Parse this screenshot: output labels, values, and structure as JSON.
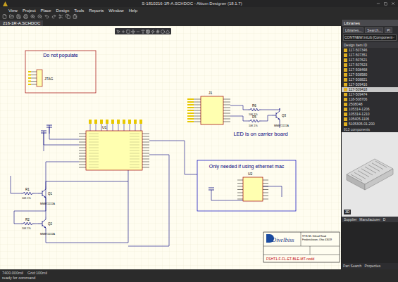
{
  "window": {
    "title": "S-1810216-1R-A.SCHDOC - Altium Designer (18.1.7)"
  },
  "menu": [
    "View",
    "Project",
    "Place",
    "Design",
    "Tools",
    "Reports",
    "Window",
    "Help"
  ],
  "document_tab": {
    "label": "216-1R-A.SCHDOC",
    "selected": true
  },
  "schematic": {
    "notes": {
      "do_not_populate": "Do not populate",
      "led": "LED is on carrier board",
      "ethernet": "Only needed if using ethernet mac"
    },
    "jtag": "JTAG",
    "u1": "U1",
    "u2": "U2",
    "j1": "J1",
    "resistors": [
      {
        "designator": "R1",
        "value": "10K 1%"
      },
      {
        "designator": "R2",
        "value": "10K 1%"
      },
      {
        "designator": "R5",
        "value": "10K 1%"
      },
      {
        "designator": "R6",
        "value": "10K 1%"
      }
    ],
    "transistors": [
      {
        "designator": "Q1",
        "value": "MMBT2222A"
      },
      {
        "designator": "Q2",
        "value": "MMBT2222A"
      },
      {
        "designator": "Q3",
        "value": "MMBT2222A"
      }
    ],
    "title_block": {
      "company": "Divelbiss",
      "address": [
        "9776 Mt. Gilead Road",
        "Fredericktown, Ohio 43019"
      ],
      "drawing": "FSHT1-F-FL-ET-BLE-MT-nodd"
    }
  },
  "libraries_panel": {
    "title": "Libraries",
    "buttons": [
      "Libraries...",
      "Search...",
      "Pl"
    ],
    "library": "CONTNEW.IntLib [Component",
    "column": "Design Item ID",
    "items": [
      {
        "id": "117-507346",
        "selected": false
      },
      {
        "id": "117-507351",
        "selected": false
      },
      {
        "id": "117-507621",
        "selected": false
      },
      {
        "id": "117-507623",
        "selected": false
      },
      {
        "id": "117-508468",
        "selected": false
      },
      {
        "id": "117-508580",
        "selected": false
      },
      {
        "id": "117-508821",
        "selected": false
      },
      {
        "id": "117-509416",
        "selected": false
      },
      {
        "id": "117-509418",
        "selected": true
      },
      {
        "id": "117-509474",
        "selected": false
      },
      {
        "id": "118-508706",
        "selected": false
      },
      {
        "id": "2508048",
        "selected": false
      },
      {
        "id": "105314-1206",
        "selected": false
      },
      {
        "id": "105314-1210",
        "selected": false
      },
      {
        "id": "105405-1106",
        "selected": false
      },
      {
        "id": "5105305-01-200",
        "selected": false
      }
    ],
    "count": "813 components",
    "preview_button": "3D",
    "footer_columns": [
      "Supplier",
      "Manufacturer",
      "D"
    ]
  },
  "bottom_tabs": [
    {
      "label": "Part Search",
      "selected": false
    },
    {
      "label": "Properties",
      "selected": false
    }
  ],
  "status_bar": {
    "coords": "7400.000mil",
    "grid": "Grid:100mil",
    "message": "ready for command"
  }
}
